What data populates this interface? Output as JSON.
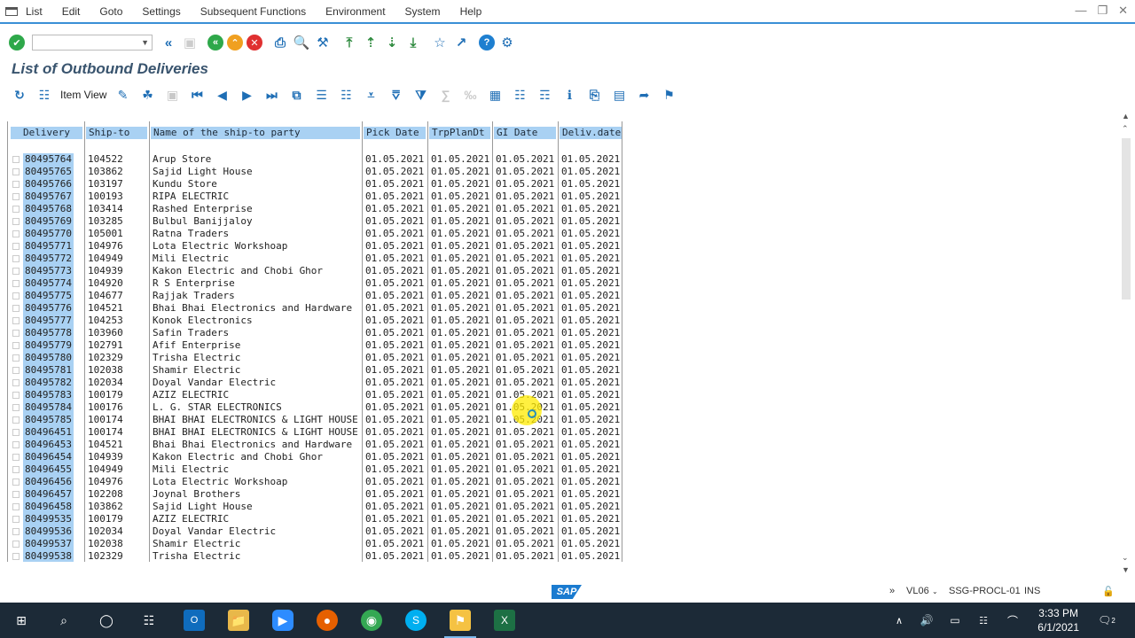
{
  "menu": [
    "List",
    "Edit",
    "Goto",
    "Settings",
    "Subsequent Functions",
    "Environment",
    "System",
    "Help"
  ],
  "title": "List of Outbound Deliveries",
  "toolbar": {
    "item_view_label": "Item View"
  },
  "columns": [
    "Delivery",
    "Ship-to",
    "Name of the ship-to party",
    "Pick Date",
    "TrpPlanDt",
    "GI Date",
    "Deliv.date"
  ],
  "rows": [
    [
      "80495764",
      "104522",
      "Arup Store",
      "01.05.2021",
      "01.05.2021",
      "01.05.2021",
      "01.05.2021"
    ],
    [
      "80495765",
      "103862",
      "Sajid Light House",
      "01.05.2021",
      "01.05.2021",
      "01.05.2021",
      "01.05.2021"
    ],
    [
      "80495766",
      "103197",
      "Kundu Store",
      "01.05.2021",
      "01.05.2021",
      "01.05.2021",
      "01.05.2021"
    ],
    [
      "80495767",
      "100193",
      "RIPA ELECTRIC",
      "01.05.2021",
      "01.05.2021",
      "01.05.2021",
      "01.05.2021"
    ],
    [
      "80495768",
      "103414",
      "Rashed Enterprise",
      "01.05.2021",
      "01.05.2021",
      "01.05.2021",
      "01.05.2021"
    ],
    [
      "80495769",
      "103285",
      "Bulbul Banijjaloy",
      "01.05.2021",
      "01.05.2021",
      "01.05.2021",
      "01.05.2021"
    ],
    [
      "80495770",
      "105001",
      "Ratna Traders",
      "01.05.2021",
      "01.05.2021",
      "01.05.2021",
      "01.05.2021"
    ],
    [
      "80495771",
      "104976",
      "Lota Electric Workshoap",
      "01.05.2021",
      "01.05.2021",
      "01.05.2021",
      "01.05.2021"
    ],
    [
      "80495772",
      "104949",
      "Mili Electric",
      "01.05.2021",
      "01.05.2021",
      "01.05.2021",
      "01.05.2021"
    ],
    [
      "80495773",
      "104939",
      "Kakon Electric and Chobi Ghor",
      "01.05.2021",
      "01.05.2021",
      "01.05.2021",
      "01.05.2021"
    ],
    [
      "80495774",
      "104920",
      "R S Enterprise",
      "01.05.2021",
      "01.05.2021",
      "01.05.2021",
      "01.05.2021"
    ],
    [
      "80495775",
      "104677",
      "Rajjak Traders",
      "01.05.2021",
      "01.05.2021",
      "01.05.2021",
      "01.05.2021"
    ],
    [
      "80495776",
      "104521",
      "Bhai Bhai Electronics and Hardware",
      "01.05.2021",
      "01.05.2021",
      "01.05.2021",
      "01.05.2021"
    ],
    [
      "80495777",
      "104253",
      "Konok Electronics",
      "01.05.2021",
      "01.05.2021",
      "01.05.2021",
      "01.05.2021"
    ],
    [
      "80495778",
      "103960",
      "Safin Traders",
      "01.05.2021",
      "01.05.2021",
      "01.05.2021",
      "01.05.2021"
    ],
    [
      "80495779",
      "102791",
      "Afif Enterprise",
      "01.05.2021",
      "01.05.2021",
      "01.05.2021",
      "01.05.2021"
    ],
    [
      "80495780",
      "102329",
      "Trisha Electric",
      "01.05.2021",
      "01.05.2021",
      "01.05.2021",
      "01.05.2021"
    ],
    [
      "80495781",
      "102038",
      "Shamir Electric",
      "01.05.2021",
      "01.05.2021",
      "01.05.2021",
      "01.05.2021"
    ],
    [
      "80495782",
      "102034",
      "Doyal Vandar Electric",
      "01.05.2021",
      "01.05.2021",
      "01.05.2021",
      "01.05.2021"
    ],
    [
      "80495783",
      "100179",
      "AZIZ ELECTRIC",
      "01.05.2021",
      "01.05.2021",
      "01.05.2021",
      "01.05.2021"
    ],
    [
      "80495784",
      "100176",
      "L. G. STAR ELECTRONICS",
      "01.05.2021",
      "01.05.2021",
      "01.05.2021",
      "01.05.2021"
    ],
    [
      "80495785",
      "100174",
      "BHAI BHAI ELECTRONICS & LIGHT HOUSE",
      "01.05.2021",
      "01.05.2021",
      "01.05.2021",
      "01.05.2021"
    ],
    [
      "80496451",
      "100174",
      "BHAI BHAI ELECTRONICS & LIGHT HOUSE",
      "01.05.2021",
      "01.05.2021",
      "01.05.2021",
      "01.05.2021"
    ],
    [
      "80496453",
      "104521",
      "Bhai Bhai Electronics and Hardware",
      "01.05.2021",
      "01.05.2021",
      "01.05.2021",
      "01.05.2021"
    ],
    [
      "80496454",
      "104939",
      "Kakon Electric and Chobi Ghor",
      "01.05.2021",
      "01.05.2021",
      "01.05.2021",
      "01.05.2021"
    ],
    [
      "80496455",
      "104949",
      "Mili Electric",
      "01.05.2021",
      "01.05.2021",
      "01.05.2021",
      "01.05.2021"
    ],
    [
      "80496456",
      "104976",
      "Lota Electric Workshoap",
      "01.05.2021",
      "01.05.2021",
      "01.05.2021",
      "01.05.2021"
    ],
    [
      "80496457",
      "102208",
      "Joynal Brothers",
      "01.05.2021",
      "01.05.2021",
      "01.05.2021",
      "01.05.2021"
    ],
    [
      "80496458",
      "103862",
      "Sajid Light House",
      "01.05.2021",
      "01.05.2021",
      "01.05.2021",
      "01.05.2021"
    ],
    [
      "80499535",
      "100179",
      "AZIZ ELECTRIC",
      "01.05.2021",
      "01.05.2021",
      "01.05.2021",
      "01.05.2021"
    ],
    [
      "80499536",
      "102034",
      "Doyal Vandar Electric",
      "01.05.2021",
      "01.05.2021",
      "01.05.2021",
      "01.05.2021"
    ],
    [
      "80499537",
      "102038",
      "Shamir Electric",
      "01.05.2021",
      "01.05.2021",
      "01.05.2021",
      "01.05.2021"
    ],
    [
      "80499538",
      "102329",
      "Trisha Electric",
      "01.05.2021",
      "01.05.2021",
      "01.05.2021",
      "01.05.2021"
    ]
  ],
  "status": {
    "system": "VL06",
    "server": "SSG-PROCL-01",
    "mode": "INS",
    "logo": "SAP"
  },
  "taskbar": {
    "time": "3:33 PM",
    "date": "6/1/2021",
    "notifications": "2"
  },
  "colors": {
    "header_bg": "#a9d1f3",
    "accent": "#3a8fd6",
    "title": "#39546e"
  }
}
